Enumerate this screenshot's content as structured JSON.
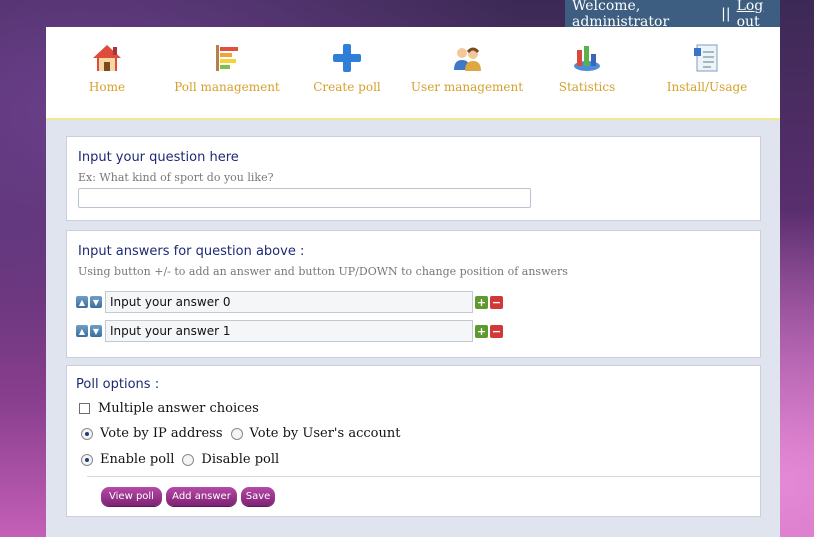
{
  "topbar": {
    "welcome": "Welcome, administrator",
    "separator": "||",
    "logout": "Log out"
  },
  "nav": [
    {
      "label": "Home",
      "icon": "home-icon"
    },
    {
      "label": "Poll management",
      "icon": "poll-management-icon"
    },
    {
      "label": "Create poll",
      "icon": "plus-icon"
    },
    {
      "label": "User management",
      "icon": "users-icon"
    },
    {
      "label": "Statistics",
      "icon": "statistics-icon"
    },
    {
      "label": "Install/Usage",
      "icon": "document-icon"
    }
  ],
  "question": {
    "title": "Input your question here",
    "hint": "Ex: What kind of sport do you like?",
    "value": ""
  },
  "answers": {
    "title": "Input answers for question above :",
    "hint": "Using button +/- to add an answer and button UP/DOWN to change position of answers",
    "items": [
      "Input your answer 0",
      "Input your answer 1"
    ]
  },
  "options": {
    "title": "Poll options :",
    "multiple_label": "Multiple answer choices",
    "multiple_checked": false,
    "vote_ip_label": "Vote by IP address",
    "vote_account_label": "Vote by User's account",
    "vote_selected": "ip",
    "enable_label": "Enable poll",
    "disable_label": "Disable poll",
    "status_selected": "enable"
  },
  "buttons": {
    "view": "View poll",
    "add": "Add answer",
    "save": "Save"
  },
  "colors": {
    "nav_text": "#d6a02b",
    "title_text": "#1d2a73",
    "button": "#9b3590",
    "topbar": "#3d5e80"
  }
}
